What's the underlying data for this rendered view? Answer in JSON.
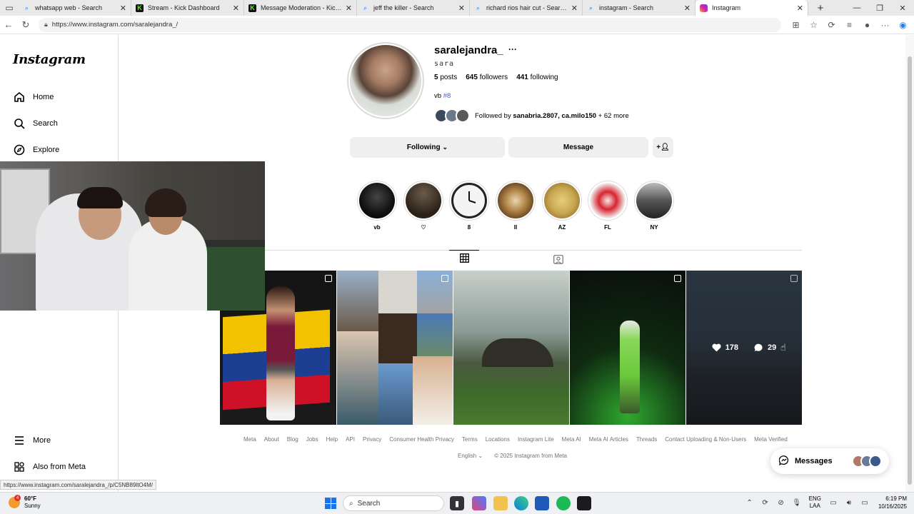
{
  "browser": {
    "tabs": [
      {
        "label": "whatsapp web - Search",
        "icon": "search-icon"
      },
      {
        "label": "Stream - Kick Dashboard",
        "icon": "kick-icon"
      },
      {
        "label": "Message Moderation - Kick Dash",
        "icon": "kick-icon"
      },
      {
        "label": "jeff the killer - Search",
        "icon": "search-icon"
      },
      {
        "label": "richard rios hair cut - Search Ima",
        "icon": "search-icon"
      },
      {
        "label": "instagram - Search",
        "icon": "search-icon"
      },
      {
        "label": "Instagram",
        "icon": "instagram-icon"
      }
    ],
    "url": "https://www.instagram.com/saralejandra_/",
    "status_url": "https://www.instagram.com/saralejandra_/p/C5NB89ltO4M/"
  },
  "sidebar": {
    "logo": "Instagram",
    "items": [
      {
        "label": "Home",
        "icon": "home-icon"
      },
      {
        "label": "Search",
        "icon": "search-icon"
      },
      {
        "label": "Explore",
        "icon": "compass-icon"
      }
    ],
    "bottom_items": [
      {
        "label": "More",
        "icon": "menu-icon"
      },
      {
        "label": "Also from Meta",
        "icon": "meta-apps-icon"
      }
    ]
  },
  "profile": {
    "username": "saralejandra_",
    "more": "···",
    "full_name": "sara",
    "posts_count": "5",
    "posts_label": "posts",
    "followers_count": "645",
    "followers_label": "followers",
    "following_count": "441",
    "following_label": "following",
    "bio_text": "vb",
    "bio_tag": "#8",
    "followed_prefix": "Followed by",
    "followed_names": "sanabria.2807, ca.milo150",
    "followed_suffix": "+ 62 more",
    "following_button": "Following",
    "message_button": "Message"
  },
  "highlights": [
    {
      "label": "vb",
      "color": "#111111"
    },
    {
      "label": "♡",
      "color": "#3a2a1c"
    },
    {
      "label": "8",
      "color": "#e8e8e8"
    },
    {
      "label": "II",
      "color": "#b3874a"
    },
    {
      "label": "AZ",
      "color": "#c9a650"
    },
    {
      "label": "FL",
      "color": "#d8242f"
    },
    {
      "label": "NY",
      "color": "#555555"
    }
  ],
  "posts": [
    {
      "colors": [
        "#1a1a1a",
        "#f2c200"
      ],
      "multi": true
    },
    {
      "colors": [
        "#7a6a58",
        "#4a6a8a"
      ],
      "multi": true
    },
    {
      "colors": [
        "#a9b7b1",
        "#3b5a2a"
      ],
      "multi": false
    },
    {
      "colors": [
        "#0d140e",
        "#2a8a2a"
      ],
      "multi": true
    },
    {
      "colors": [
        "#34414f",
        "#1e2227"
      ],
      "multi": true,
      "likes": "178",
      "comments": "29"
    }
  ],
  "footer": {
    "links": [
      "Meta",
      "About",
      "Blog",
      "Jobs",
      "Help",
      "API",
      "Privacy",
      "Consumer Health Privacy",
      "Terms",
      "Locations",
      "Instagram Lite",
      "Meta AI",
      "Meta AI Articles",
      "Threads",
      "Contact Uploading & Non-Users",
      "Meta Verified"
    ],
    "language": "English",
    "copyright": "© 2025 Instagram from Meta"
  },
  "messages_label": "Messages",
  "taskbar": {
    "temp": "60°F",
    "weather": "Sunny",
    "weather_badge": "4",
    "search": "Search",
    "lang_top": "ENG",
    "lang_bottom": "LAA",
    "time": "6:19 PM",
    "date": "10/16/2025"
  }
}
